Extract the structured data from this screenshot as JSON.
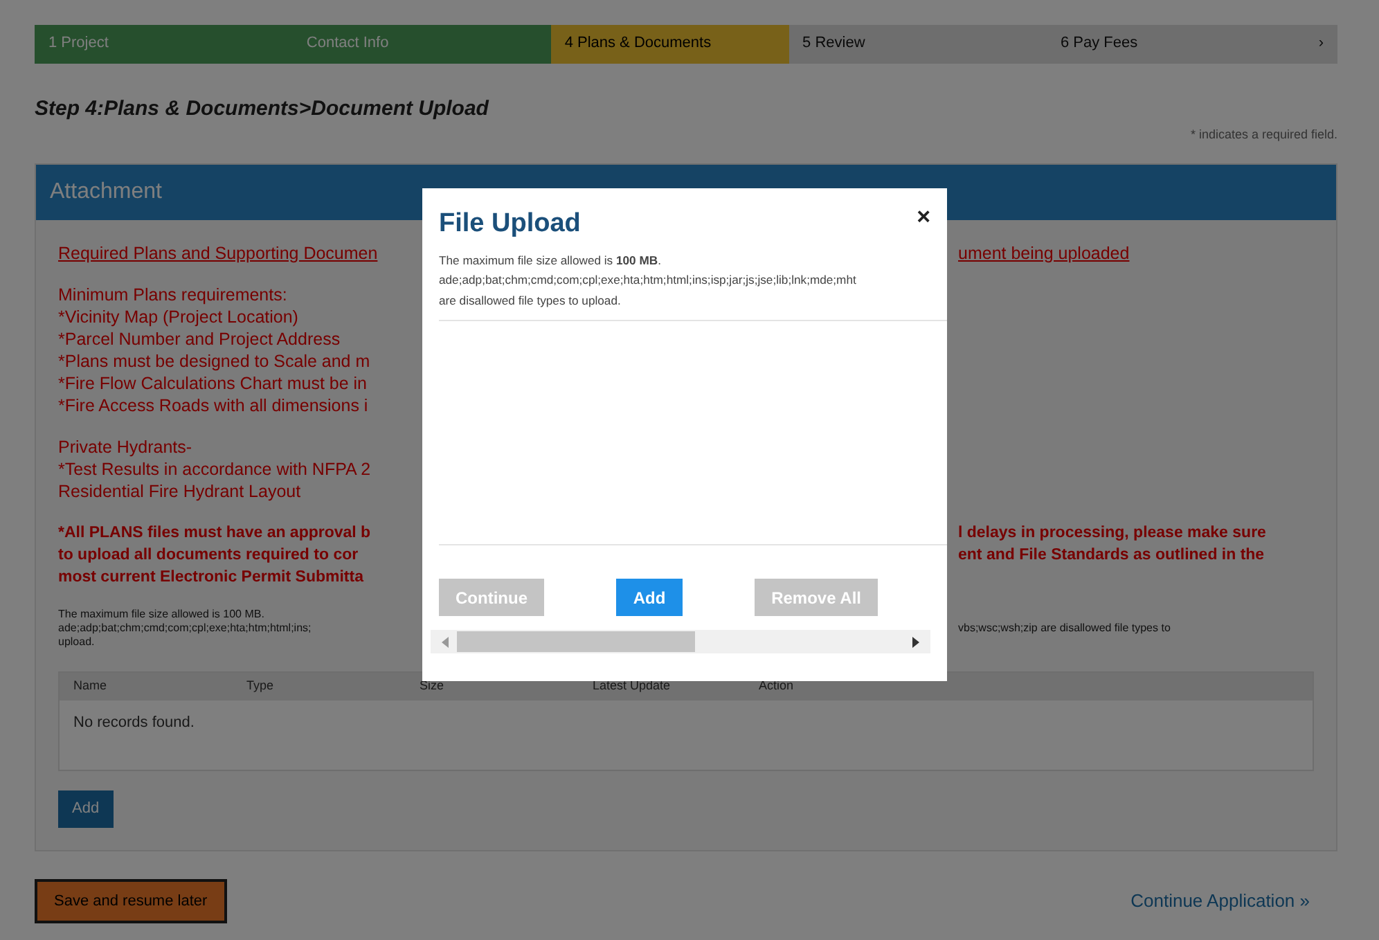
{
  "steps": [
    {
      "label": "1 Project",
      "done": true,
      "selected": false
    },
    {
      "label": "Contact Info",
      "done": true,
      "selected": false
    },
    {
      "label": "4 Plans & Documents",
      "done": false,
      "selected": true
    },
    {
      "label": "5 Review",
      "done": false,
      "selected": false
    },
    {
      "label": "6 Pay Fees",
      "done": false,
      "selected": false
    }
  ],
  "steps_more": "›",
  "breadcrumb": "Step 4:Plans & Documents>Document Upload",
  "required_note": "* indicates a required field.",
  "panel": {
    "title": "Attachment",
    "paragraphs": [
      {
        "kind": "link",
        "lines": [
          {
            "left": "Required Plans and Supporting Documen",
            "right": "ument being uploaded"
          }
        ]
      },
      {
        "kind": "text",
        "lines": [
          {
            "left": "Minimum Plans requirements:"
          },
          {
            "left": "*Vicinity Map (Project Location)"
          },
          {
            "left": "*Parcel Number and Project Address"
          },
          {
            "left": "*Plans must be designed to Scale and m"
          },
          {
            "left": "*Fire Flow Calculations Chart must be in"
          },
          {
            "left": "*Fire Access Roads with all dimensions i"
          }
        ]
      },
      {
        "kind": "text",
        "lines": [
          {
            "left": "Private Hydrants-"
          },
          {
            "left": "*Test Results in accordance with NFPA 2"
          },
          {
            "left": "Residential Fire Hydrant Layout"
          }
        ]
      },
      {
        "kind": "bold",
        "lines": [
          {
            "left": "*All PLANS files must have an approval b",
            "right": "l delays in processing, please make sure"
          },
          {
            "left": "to upload all documents required to cor",
            "right": "ent and File Standards as outlined in the"
          },
          {
            "left": "most current Electronic Permit Submitta"
          }
        ]
      }
    ],
    "file_note": [
      {
        "left": "The maximum file size allowed is 100 MB."
      },
      {
        "left": "ade;adp;bat;chm;cmd;com;cpl;exe;hta;htm;html;ins;",
        "right": "vbs;wsc;wsh;zip are disallowed file types to"
      },
      {
        "left": "upload."
      }
    ],
    "table": {
      "columns": [
        "Name",
        "Type",
        "Size",
        "Latest Update",
        "Action"
      ],
      "empty": "No records found."
    },
    "add_button": "Add"
  },
  "save_button": "Save and resume later",
  "continue_link": "Continue Application »",
  "modal": {
    "title": "File Upload",
    "close": "×",
    "size_note": "The maximum file size allowed is **100 MB**.",
    "types": "ade;adp;bat;chm;cmd;com;cpl;exe;hta;htm;html;ins;isp;jar;js;jse;lib;lnk;mde;mht",
    "types_note": "are disallowed file types to upload.",
    "buttons": [
      {
        "label": "Continue",
        "disabled": true
      },
      {
        "label": "Add",
        "disabled": false
      },
      {
        "label": "Remove All",
        "disabled": true
      }
    ]
  }
}
